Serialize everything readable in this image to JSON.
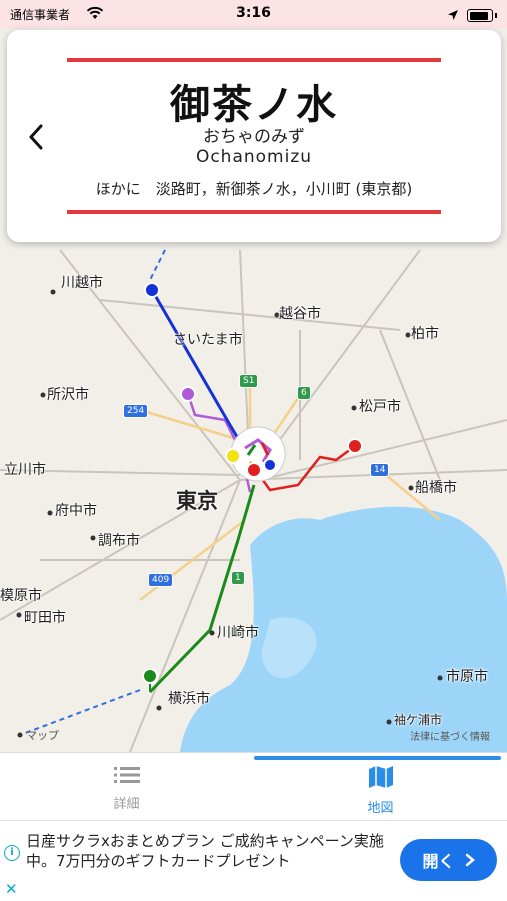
{
  "status": {
    "carrier": "通信事業者",
    "time": "3:16"
  },
  "station": {
    "name": "御茶ノ水",
    "kana": "おちゃのみず",
    "romaji": "Ochanomizu",
    "others": "ほかに　淡路町，新御茶ノ水，小川町 (東京都)"
  },
  "map": {
    "labels": {
      "kawagoe": "川越市",
      "koshigaya": "越谷市",
      "saitama": "さいたま市",
      "kashiwa": "柏市",
      "tokorozawa": "所沢市",
      "matsudo": "松戸市",
      "tachikawa": "立川市",
      "tokyo": "東京",
      "funabashi": "船橋市",
      "fuchu": "府中市",
      "chofu": "調布市",
      "sagamihara": "模原市",
      "machida": "町田市",
      "kawasaki": "川崎市",
      "yokohama": "横浜市",
      "ichihara": "市原市",
      "sodegaura": "袖ケ浦市"
    },
    "shields": {
      "s1": "S1",
      "r6": "6",
      "r254": "254",
      "r14": "14",
      "r409": "409",
      "r1": "1"
    },
    "attribution_maps": "マップ",
    "attribution_legal": "法律に基づく情報",
    "colors": {
      "blue_line": "#1432d8",
      "green_line": "#1a8a1a",
      "red_line": "#e02020",
      "purple_line": "#b05ad8",
      "water": "#9dd5f8"
    }
  },
  "tabs": {
    "details": "詳細",
    "map": "地図",
    "active": "map"
  },
  "ad": {
    "text": "日産サクラxおまとめプラン ご成約キャンペーン実施中。7万円分のギフトカードプレゼント",
    "button": "開く"
  }
}
